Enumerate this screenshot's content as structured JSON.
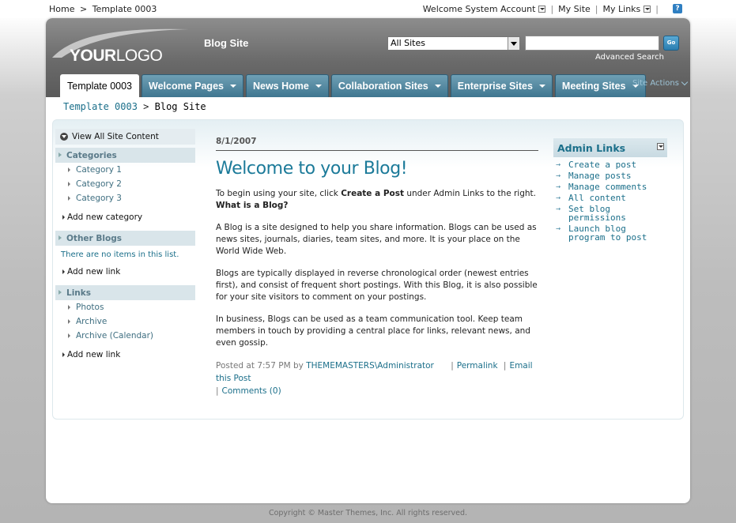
{
  "util": {
    "home": "Home",
    "separator": ">",
    "current": "Template 0003",
    "welcome": "Welcome System Account",
    "my_site": "My Site",
    "my_links": "My Links",
    "bar": "|"
  },
  "header": {
    "logo_bold": "YOUR",
    "logo_light": "LOGO",
    "site_title": "Blog Site",
    "search_scope": "All Sites",
    "search_placeholder": "",
    "go_label": "Go",
    "advanced_search": "Advanced Search"
  },
  "tabs": [
    {
      "label": "Template 0003",
      "selected": true
    },
    {
      "label": "Welcome Pages"
    },
    {
      "label": "News Home"
    },
    {
      "label": "Collaboration Sites"
    },
    {
      "label": "Enterprise Sites"
    },
    {
      "label": "Meeting Sites"
    }
  ],
  "site_actions": "Site Actions",
  "breadcrumb": {
    "root": "Template 0003",
    "sep": ">",
    "current": "Blog Site"
  },
  "left_nav": {
    "view_all": "View All Site Content",
    "categories_head": "Categories",
    "categories": [
      "Category 1",
      "Category 2",
      "Category 3"
    ],
    "add_category": "Add new category",
    "other_blogs_head": "Other Blogs",
    "other_blogs_empty": "There are no items in this list.",
    "add_link_1": "Add new link",
    "links_head": "Links",
    "links": [
      "Photos",
      "Archive",
      "Archive (Calendar)"
    ],
    "add_link_2": "Add new link"
  },
  "post": {
    "date": "8/1/2007",
    "title": "Welcome to your Blog!",
    "intro_pre": "To begin using your site, click ",
    "intro_bold": "Create a Post",
    "intro_post": " under Admin Links to the right.",
    "what_is": "What is a Blog?",
    "p1": "A Blog is a site designed to help you share information. Blogs can be used as news sites, journals, diaries, team sites, and more. It is your place on the World Wide Web.",
    "p2": "Blogs are typically displayed in reverse chronological order (newest entries first), and consist of frequent short postings. With this Blog, it is also possible for your site visitors to comment on your postings.",
    "p3": "In business, Blogs can be used as a team communication tool. Keep team members in touch by providing a central place for links, relevant news, and even gossip.",
    "posted_at": "Posted at 7:57 PM by ",
    "author": "THEMEMASTERS\\Administrator",
    "permalink": "Permalink",
    "email": "Email this Post",
    "comments": "Comments (0)"
  },
  "admin": {
    "head": "Admin Links",
    "items": [
      "Create a post",
      "Manage posts",
      "Manage comments",
      "All content",
      "Set blog permissions",
      "Launch blog program to post"
    ]
  },
  "copyright": "Copyright © Master Themes, Inc. All rights reserved."
}
